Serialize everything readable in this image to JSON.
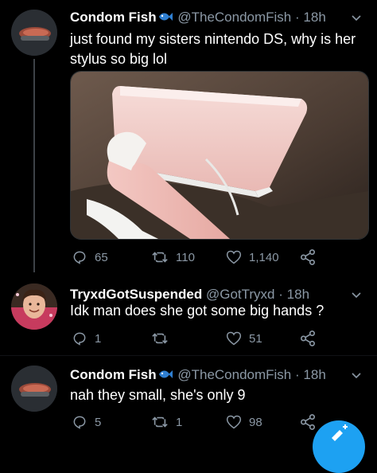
{
  "tweets": [
    {
      "display_name": "Condom Fish",
      "name_emoji": "fish-emoji",
      "handle": "@TheCondomFish",
      "separator": "·",
      "time": "18h",
      "text": "just found my sisters nintendo DS, why is her stylus so big lol",
      "replies": "65",
      "retweets": "110",
      "likes": "1,140"
    },
    {
      "display_name": "TryxdGotSuspended",
      "handle": "@GotTryxd",
      "separator": "·",
      "time": "18h",
      "text": "Idk man does she got some big hands ?",
      "replies": "1",
      "retweets": "",
      "likes": "51"
    },
    {
      "display_name": "Condom Fish",
      "name_emoji": "fish-emoji",
      "handle": "@TheCondomFish",
      "separator": "·",
      "time": "18h",
      "text": "nah they small, she's only 9",
      "replies": "5",
      "retweets": "1",
      "likes": "98"
    }
  ],
  "colors": {
    "background": "#000000",
    "secondary_text": "#8b98a5",
    "primary_text": "#ffffff",
    "accent": "#1da1f2"
  },
  "icons": [
    "reply-icon",
    "retweet-icon",
    "like-icon",
    "share-icon",
    "chevron-down-icon",
    "fish-emoji"
  ]
}
